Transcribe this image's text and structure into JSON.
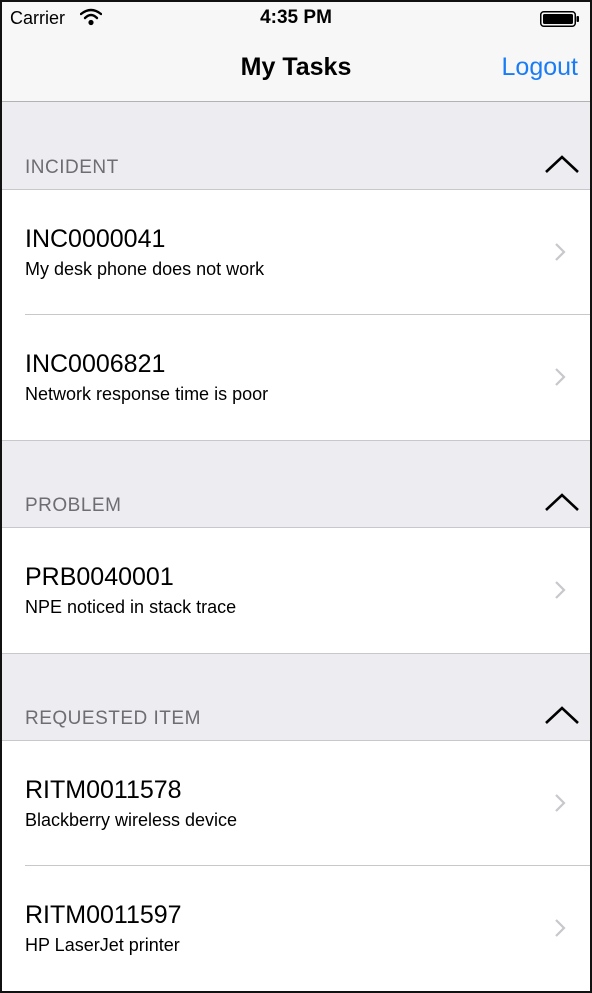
{
  "status_bar": {
    "carrier": "Carrier",
    "time": "4:35 PM",
    "wifi_icon": "wifi-icon",
    "battery_icon": "battery-icon"
  },
  "nav": {
    "title": "My Tasks",
    "logout_label": "Logout",
    "accent_color": "#1a7cf5"
  },
  "sections": [
    {
      "title": "INCIDENT",
      "toggle_icon": "chevron-up-icon",
      "items": [
        {
          "number": "INC0000041",
          "description": "My desk phone does not work"
        },
        {
          "number": "INC0006821",
          "description": "Network response time is poor"
        }
      ]
    },
    {
      "title": "PROBLEM",
      "toggle_icon": "chevron-up-icon",
      "items": [
        {
          "number": "PRB0040001",
          "description": "NPE noticed in stack trace"
        }
      ]
    },
    {
      "title": "REQUESTED ITEM",
      "toggle_icon": "chevron-up-icon",
      "items": [
        {
          "number": "RITM0011578",
          "description": "Blackberry wireless device"
        },
        {
          "number": "RITM0011597",
          "description": "HP LaserJet printer"
        }
      ]
    }
  ]
}
